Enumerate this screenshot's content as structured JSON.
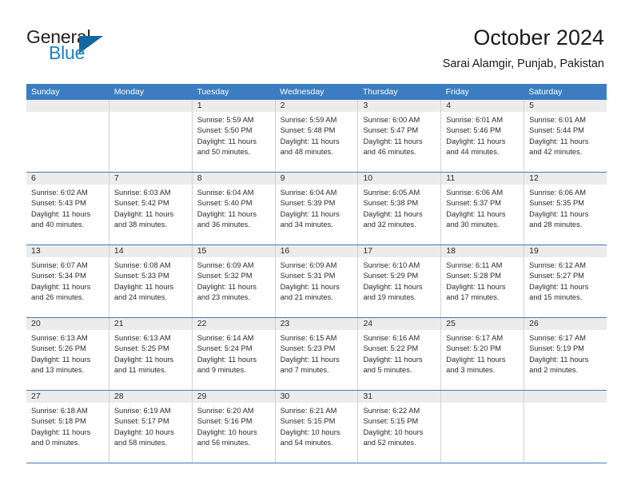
{
  "brand": {
    "name_primary": "General",
    "name_secondary": "Blue",
    "triangle_icon": "blue-triangle-icon",
    "accent_color": "#1f7fc4",
    "triangle_color": "#14669e"
  },
  "header": {
    "title": "October 2024",
    "subtitle": "Sarai Alamgir, Punjab, Pakistan"
  },
  "calendar": {
    "header_bg_color": "#3b7dc0",
    "daynum_bg_color": "#ececec",
    "weekdays": [
      "Sunday",
      "Monday",
      "Tuesday",
      "Wednesday",
      "Thursday",
      "Friday",
      "Saturday"
    ],
    "weeks": [
      [
        {
          "day": "",
          "empty": true,
          "sunrise": "",
          "sunset": "",
          "daylight_line1": "",
          "daylight_line2": ""
        },
        {
          "day": "",
          "empty": true,
          "sunrise": "",
          "sunset": "",
          "daylight_line1": "",
          "daylight_line2": ""
        },
        {
          "day": "1",
          "sunrise": "Sunrise: 5:59 AM",
          "sunset": "Sunset: 5:50 PM",
          "daylight_line1": "Daylight: 11 hours",
          "daylight_line2": "and 50 minutes."
        },
        {
          "day": "2",
          "sunrise": "Sunrise: 5:59 AM",
          "sunset": "Sunset: 5:48 PM",
          "daylight_line1": "Daylight: 11 hours",
          "daylight_line2": "and 48 minutes."
        },
        {
          "day": "3",
          "sunrise": "Sunrise: 6:00 AM",
          "sunset": "Sunset: 5:47 PM",
          "daylight_line1": "Daylight: 11 hours",
          "daylight_line2": "and 46 minutes."
        },
        {
          "day": "4",
          "sunrise": "Sunrise: 6:01 AM",
          "sunset": "Sunset: 5:46 PM",
          "daylight_line1": "Daylight: 11 hours",
          "daylight_line2": "and 44 minutes."
        },
        {
          "day": "5",
          "sunrise": "Sunrise: 6:01 AM",
          "sunset": "Sunset: 5:44 PM",
          "daylight_line1": "Daylight: 11 hours",
          "daylight_line2": "and 42 minutes."
        }
      ],
      [
        {
          "day": "6",
          "sunrise": "Sunrise: 6:02 AM",
          "sunset": "Sunset: 5:43 PM",
          "daylight_line1": "Daylight: 11 hours",
          "daylight_line2": "and 40 minutes."
        },
        {
          "day": "7",
          "sunrise": "Sunrise: 6:03 AM",
          "sunset": "Sunset: 5:42 PM",
          "daylight_line1": "Daylight: 11 hours",
          "daylight_line2": "and 38 minutes."
        },
        {
          "day": "8",
          "sunrise": "Sunrise: 6:04 AM",
          "sunset": "Sunset: 5:40 PM",
          "daylight_line1": "Daylight: 11 hours",
          "daylight_line2": "and 36 minutes."
        },
        {
          "day": "9",
          "sunrise": "Sunrise: 6:04 AM",
          "sunset": "Sunset: 5:39 PM",
          "daylight_line1": "Daylight: 11 hours",
          "daylight_line2": "and 34 minutes."
        },
        {
          "day": "10",
          "sunrise": "Sunrise: 6:05 AM",
          "sunset": "Sunset: 5:38 PM",
          "daylight_line1": "Daylight: 11 hours",
          "daylight_line2": "and 32 minutes."
        },
        {
          "day": "11",
          "sunrise": "Sunrise: 6:06 AM",
          "sunset": "Sunset: 5:37 PM",
          "daylight_line1": "Daylight: 11 hours",
          "daylight_line2": "and 30 minutes."
        },
        {
          "day": "12",
          "sunrise": "Sunrise: 6:06 AM",
          "sunset": "Sunset: 5:35 PM",
          "daylight_line1": "Daylight: 11 hours",
          "daylight_line2": "and 28 minutes."
        }
      ],
      [
        {
          "day": "13",
          "sunrise": "Sunrise: 6:07 AM",
          "sunset": "Sunset: 5:34 PM",
          "daylight_line1": "Daylight: 11 hours",
          "daylight_line2": "and 26 minutes."
        },
        {
          "day": "14",
          "sunrise": "Sunrise: 6:08 AM",
          "sunset": "Sunset: 5:33 PM",
          "daylight_line1": "Daylight: 11 hours",
          "daylight_line2": "and 24 minutes."
        },
        {
          "day": "15",
          "sunrise": "Sunrise: 6:09 AM",
          "sunset": "Sunset: 5:32 PM",
          "daylight_line1": "Daylight: 11 hours",
          "daylight_line2": "and 23 minutes."
        },
        {
          "day": "16",
          "sunrise": "Sunrise: 6:09 AM",
          "sunset": "Sunset: 5:31 PM",
          "daylight_line1": "Daylight: 11 hours",
          "daylight_line2": "and 21 minutes."
        },
        {
          "day": "17",
          "sunrise": "Sunrise: 6:10 AM",
          "sunset": "Sunset: 5:29 PM",
          "daylight_line1": "Daylight: 11 hours",
          "daylight_line2": "and 19 minutes."
        },
        {
          "day": "18",
          "sunrise": "Sunrise: 6:11 AM",
          "sunset": "Sunset: 5:28 PM",
          "daylight_line1": "Daylight: 11 hours",
          "daylight_line2": "and 17 minutes."
        },
        {
          "day": "19",
          "sunrise": "Sunrise: 6:12 AM",
          "sunset": "Sunset: 5:27 PM",
          "daylight_line1": "Daylight: 11 hours",
          "daylight_line2": "and 15 minutes."
        }
      ],
      [
        {
          "day": "20",
          "sunrise": "Sunrise: 6:13 AM",
          "sunset": "Sunset: 5:26 PM",
          "daylight_line1": "Daylight: 11 hours",
          "daylight_line2": "and 13 minutes."
        },
        {
          "day": "21",
          "sunrise": "Sunrise: 6:13 AM",
          "sunset": "Sunset: 5:25 PM",
          "daylight_line1": "Daylight: 11 hours",
          "daylight_line2": "and 11 minutes."
        },
        {
          "day": "22",
          "sunrise": "Sunrise: 6:14 AM",
          "sunset": "Sunset: 5:24 PM",
          "daylight_line1": "Daylight: 11 hours",
          "daylight_line2": "and 9 minutes."
        },
        {
          "day": "23",
          "sunrise": "Sunrise: 6:15 AM",
          "sunset": "Sunset: 5:23 PM",
          "daylight_line1": "Daylight: 11 hours",
          "daylight_line2": "and 7 minutes."
        },
        {
          "day": "24",
          "sunrise": "Sunrise: 6:16 AM",
          "sunset": "Sunset: 5:22 PM",
          "daylight_line1": "Daylight: 11 hours",
          "daylight_line2": "and 5 minutes."
        },
        {
          "day": "25",
          "sunrise": "Sunrise: 6:17 AM",
          "sunset": "Sunset: 5:20 PM",
          "daylight_line1": "Daylight: 11 hours",
          "daylight_line2": "and 3 minutes."
        },
        {
          "day": "26",
          "sunrise": "Sunrise: 6:17 AM",
          "sunset": "Sunset: 5:19 PM",
          "daylight_line1": "Daylight: 11 hours",
          "daylight_line2": "and 2 minutes."
        }
      ],
      [
        {
          "day": "27",
          "sunrise": "Sunrise: 6:18 AM",
          "sunset": "Sunset: 5:18 PM",
          "daylight_line1": "Daylight: 11 hours",
          "daylight_line2": "and 0 minutes."
        },
        {
          "day": "28",
          "sunrise": "Sunrise: 6:19 AM",
          "sunset": "Sunset: 5:17 PM",
          "daylight_line1": "Daylight: 10 hours",
          "daylight_line2": "and 58 minutes."
        },
        {
          "day": "29",
          "sunrise": "Sunrise: 6:20 AM",
          "sunset": "Sunset: 5:16 PM",
          "daylight_line1": "Daylight: 10 hours",
          "daylight_line2": "and 56 minutes."
        },
        {
          "day": "30",
          "sunrise": "Sunrise: 6:21 AM",
          "sunset": "Sunset: 5:15 PM",
          "daylight_line1": "Daylight: 10 hours",
          "daylight_line2": "and 54 minutes."
        },
        {
          "day": "31",
          "sunrise": "Sunrise: 6:22 AM",
          "sunset": "Sunset: 5:15 PM",
          "daylight_line1": "Daylight: 10 hours",
          "daylight_line2": "and 52 minutes."
        },
        {
          "day": "",
          "empty": true,
          "sunrise": "",
          "sunset": "",
          "daylight_line1": "",
          "daylight_line2": ""
        },
        {
          "day": "",
          "empty": true,
          "sunrise": "",
          "sunset": "",
          "daylight_line1": "",
          "daylight_line2": ""
        }
      ]
    ]
  }
}
